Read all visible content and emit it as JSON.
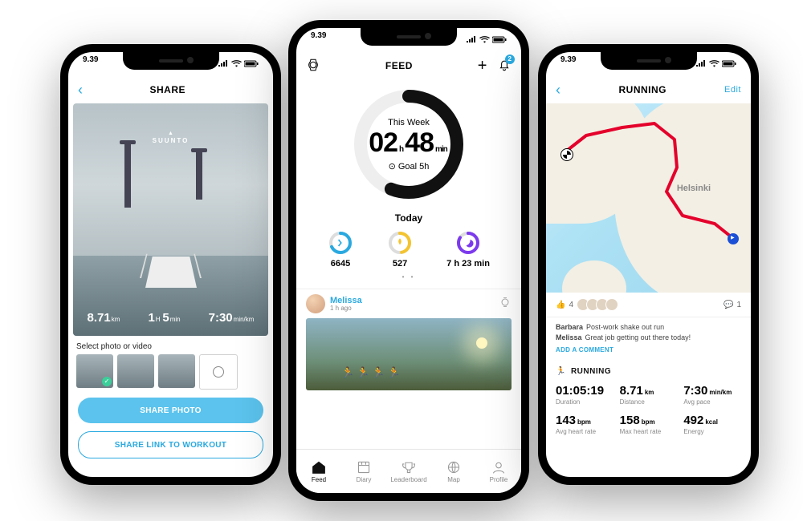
{
  "statusbar": {
    "time": "9.39"
  },
  "share": {
    "title": "SHARE",
    "brand": "SUUNTO",
    "hero_stats": {
      "distance_value": "8.71",
      "distance_unit": "km",
      "duration_value": "1",
      "duration_h_unit": "H",
      "duration_value2": "5",
      "duration_m_unit": "min",
      "pace_value": "7:30",
      "pace_unit": "min/km"
    },
    "select_label": "Select photo or video",
    "share_photo_btn": "SHARE PHOTO",
    "share_link_btn": "SHARE LINK TO WORKOUT"
  },
  "feed": {
    "title": "FEED",
    "notif_count": "2",
    "ring": {
      "label": "This Week",
      "hours": "02",
      "minutes": "48",
      "h_unit": "h",
      "m_unit": "min",
      "goal_label": "Goal 5h",
      "progress": 0.56
    },
    "today_label": "Today",
    "today": {
      "steps": "6645",
      "calories": "527",
      "sleep": "7 h 23 min"
    },
    "pager": "• •",
    "post": {
      "user": "Melissa",
      "time": "1 h ago"
    },
    "tabs": [
      "Feed",
      "Diary",
      "Leaderboard",
      "Map",
      "Profile"
    ]
  },
  "run": {
    "title": "RUNNING",
    "edit": "Edit",
    "city": "Helsinki",
    "likes": "4",
    "comment_count": "1",
    "comments": [
      {
        "u": "Barbara",
        "t": "Post-work shake out run"
      },
      {
        "u": "Melissa",
        "t": "Great job getting out there today!"
      }
    ],
    "add_comment": "ADD A COMMENT",
    "activity_label": "RUNNING",
    "stats": [
      {
        "v": "01:05:19",
        "u": "",
        "l": "Duration"
      },
      {
        "v": "8.71",
        "u": "km",
        "l": "Distance"
      },
      {
        "v": "7:30",
        "u": "min/km",
        "l": "Avg pace"
      },
      {
        "v": "143",
        "u": "bpm",
        "l": "Avg heart rate"
      },
      {
        "v": "158",
        "u": "bpm",
        "l": "Max heart rate"
      },
      {
        "v": "492",
        "u": "kcal",
        "l": "Energy"
      }
    ]
  }
}
